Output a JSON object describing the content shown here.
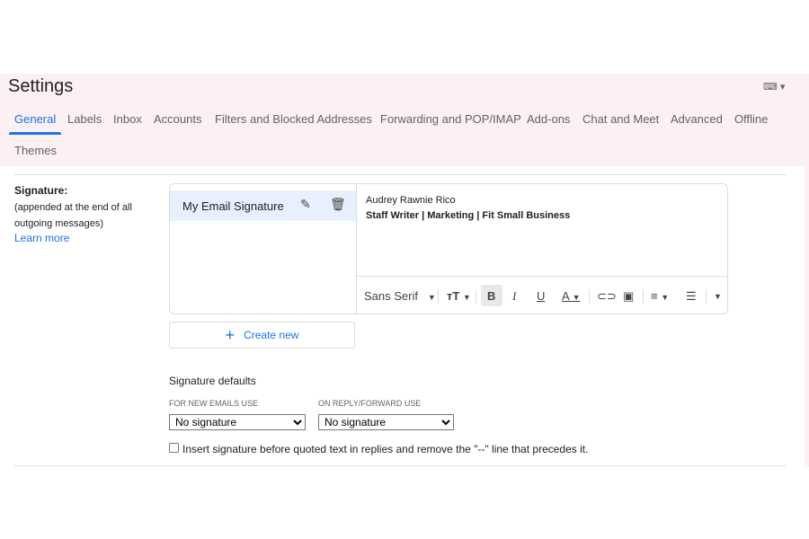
{
  "header": {
    "title": "Settings",
    "keyboard_icon": "keyboard-icon"
  },
  "tabs": [
    {
      "label": "General",
      "active": true
    },
    {
      "label": "Labels"
    },
    {
      "label": "Inbox"
    },
    {
      "label": "Accounts"
    },
    {
      "label": "Filters and Blocked Addresses"
    },
    {
      "label": "Forwarding and POP/IMAP"
    },
    {
      "label": "Add-ons"
    },
    {
      "label": "Chat and Meet"
    },
    {
      "label": "Advanced"
    },
    {
      "label": "Offline"
    },
    {
      "label": "Themes"
    }
  ],
  "signature": {
    "label": "Signature:",
    "description": "(appended at the end of all outgoing messages)",
    "learn_more": "Learn more",
    "items": [
      {
        "name": "My Email Signature"
      }
    ],
    "editor": {
      "line1": "Audrey Rawnie Rico",
      "line2": "Staff Writer | Marketing | Fit Small Business"
    },
    "toolbar": {
      "font": "Sans Serif"
    },
    "create_new": "Create new"
  },
  "defaults": {
    "title": "Signature defaults",
    "new_label": "FOR NEW EMAILS USE",
    "new_value": "No signature",
    "reply_label": "ON REPLY/FORWARD USE",
    "reply_value": "No signature",
    "checkbox_label": "Insert signature before quoted text in replies and remove the \"--\" line that precedes it.",
    "checkbox_checked": false
  },
  "colors": {
    "accent": "#1a73e8",
    "header_bg": "#fcf0f3",
    "selected_bg": "#e8f0fe"
  }
}
